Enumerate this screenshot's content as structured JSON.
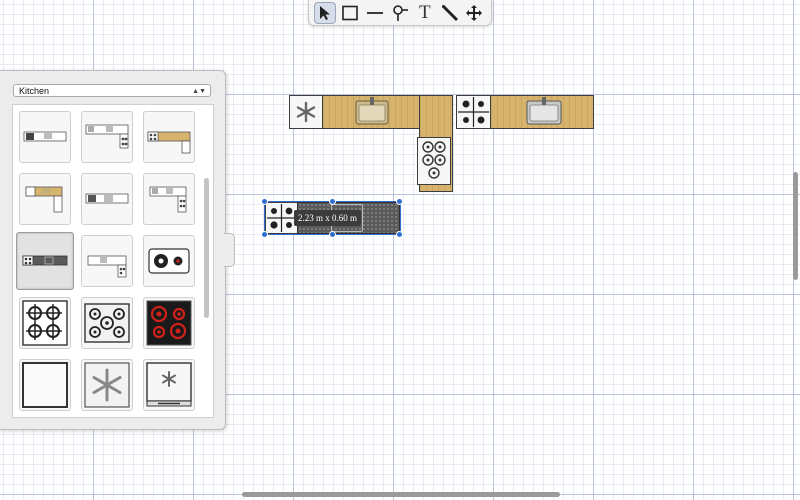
{
  "toolbar": {
    "tools": [
      {
        "icon": "pointer-icon",
        "active": true
      },
      {
        "icon": "rectangle-icon",
        "active": false
      },
      {
        "icon": "line-icon",
        "active": false
      },
      {
        "icon": "pin-icon",
        "active": false
      },
      {
        "icon": "text-icon",
        "glyph": "T",
        "active": false
      },
      {
        "icon": "ruler-icon",
        "active": false
      },
      {
        "icon": "move-icon",
        "active": false
      }
    ]
  },
  "library": {
    "category": "Kitchen",
    "items": [
      "corner-counter-sink-stove",
      "counter-sink-stove-right",
      "counter-wood-sink-stove",
      "l-counter-wood-stove",
      "l-counter-white-sink",
      "l-counter-white-stove",
      "counter-gray-sink-stove",
      "counter-white-sink-stove",
      "electric-hob-two",
      "gas-hob-four",
      "gas-hob-five",
      "ceramic-hob-red",
      "plain-cabinet",
      "fan-extractor",
      "wall-oven"
    ],
    "selected_index": 6
  },
  "canvas": {
    "selected_dimensions": "2.23 m x 0.60 m"
  },
  "colors": {
    "wood": "#d7b46d",
    "selection": "#2f6fd0",
    "hob_red": "#d0211a"
  }
}
